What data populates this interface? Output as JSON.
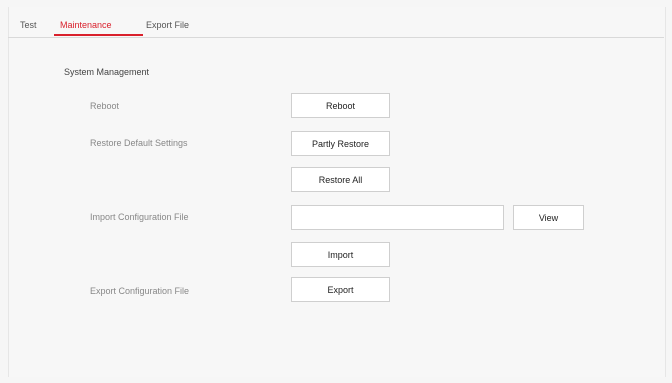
{
  "tabs": [
    {
      "label": "Test",
      "active": false
    },
    {
      "label": "Maintenance",
      "active": true
    },
    {
      "label": "Export File",
      "active": false
    }
  ],
  "accent_color": "#d9202c",
  "section": {
    "title": "System Management"
  },
  "rows": {
    "reboot": {
      "label": "Reboot",
      "button": "Reboot"
    },
    "restore": {
      "label": "Restore Default Settings",
      "partly_button": "Partly Restore",
      "all_button": "Restore All"
    },
    "import": {
      "label": "Import Configuration File",
      "input_value": "",
      "view_button": "View",
      "import_button": "Import"
    },
    "export": {
      "label": "Export Configuration File",
      "button": "Export"
    }
  }
}
